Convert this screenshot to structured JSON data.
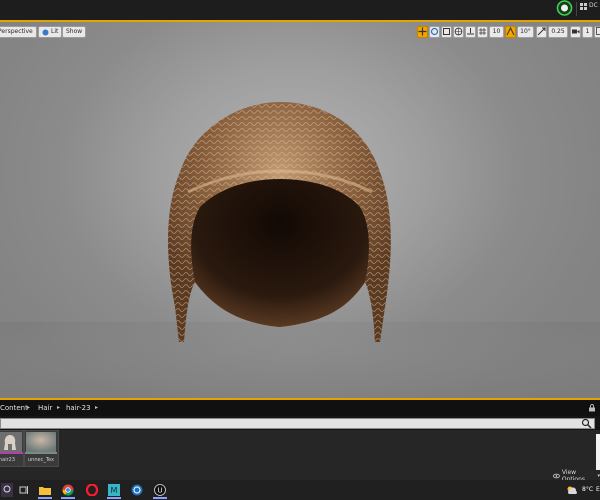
{
  "topbar": {
    "label": "DC",
    "status_icon": "ue-status-icon",
    "grid_icon": "grid-icon"
  },
  "viewport": {
    "perspective_label": "Perspective",
    "lit_label": "Lit",
    "show_label": "Show",
    "grid_snap_value": "10",
    "rotation_snap_value": "10°",
    "scale_snap_value": "0.25",
    "camera_speed_value": "1"
  },
  "content_browser": {
    "breadcrumbs": [
      "Content",
      "Hair",
      "hair-23"
    ],
    "search_placeholder": "",
    "assets": [
      {
        "name": "hair23",
        "icon": "groom-asset-thumbnail",
        "color": "#b040b0"
      },
      {
        "name": "unnec_Tex",
        "icon": "texture-thumbnail",
        "color": "#7a8a8a"
      }
    ],
    "view_options_label": "View Options"
  },
  "taskbar": {
    "items": [
      "search-icon",
      "task-view-icon",
      "file-explorer-icon",
      "chrome-icon",
      "opera-icon",
      "unreal-project-icon",
      "c4d-icon",
      "unreal-engine-icon"
    ],
    "weather_label": "8°C",
    "extra_label": "E"
  },
  "colors": {
    "accent": "#e1a400",
    "viewport_bg": "#9f9f9f",
    "panel_bg": "#262626",
    "taskbar_bg": "#202020"
  }
}
